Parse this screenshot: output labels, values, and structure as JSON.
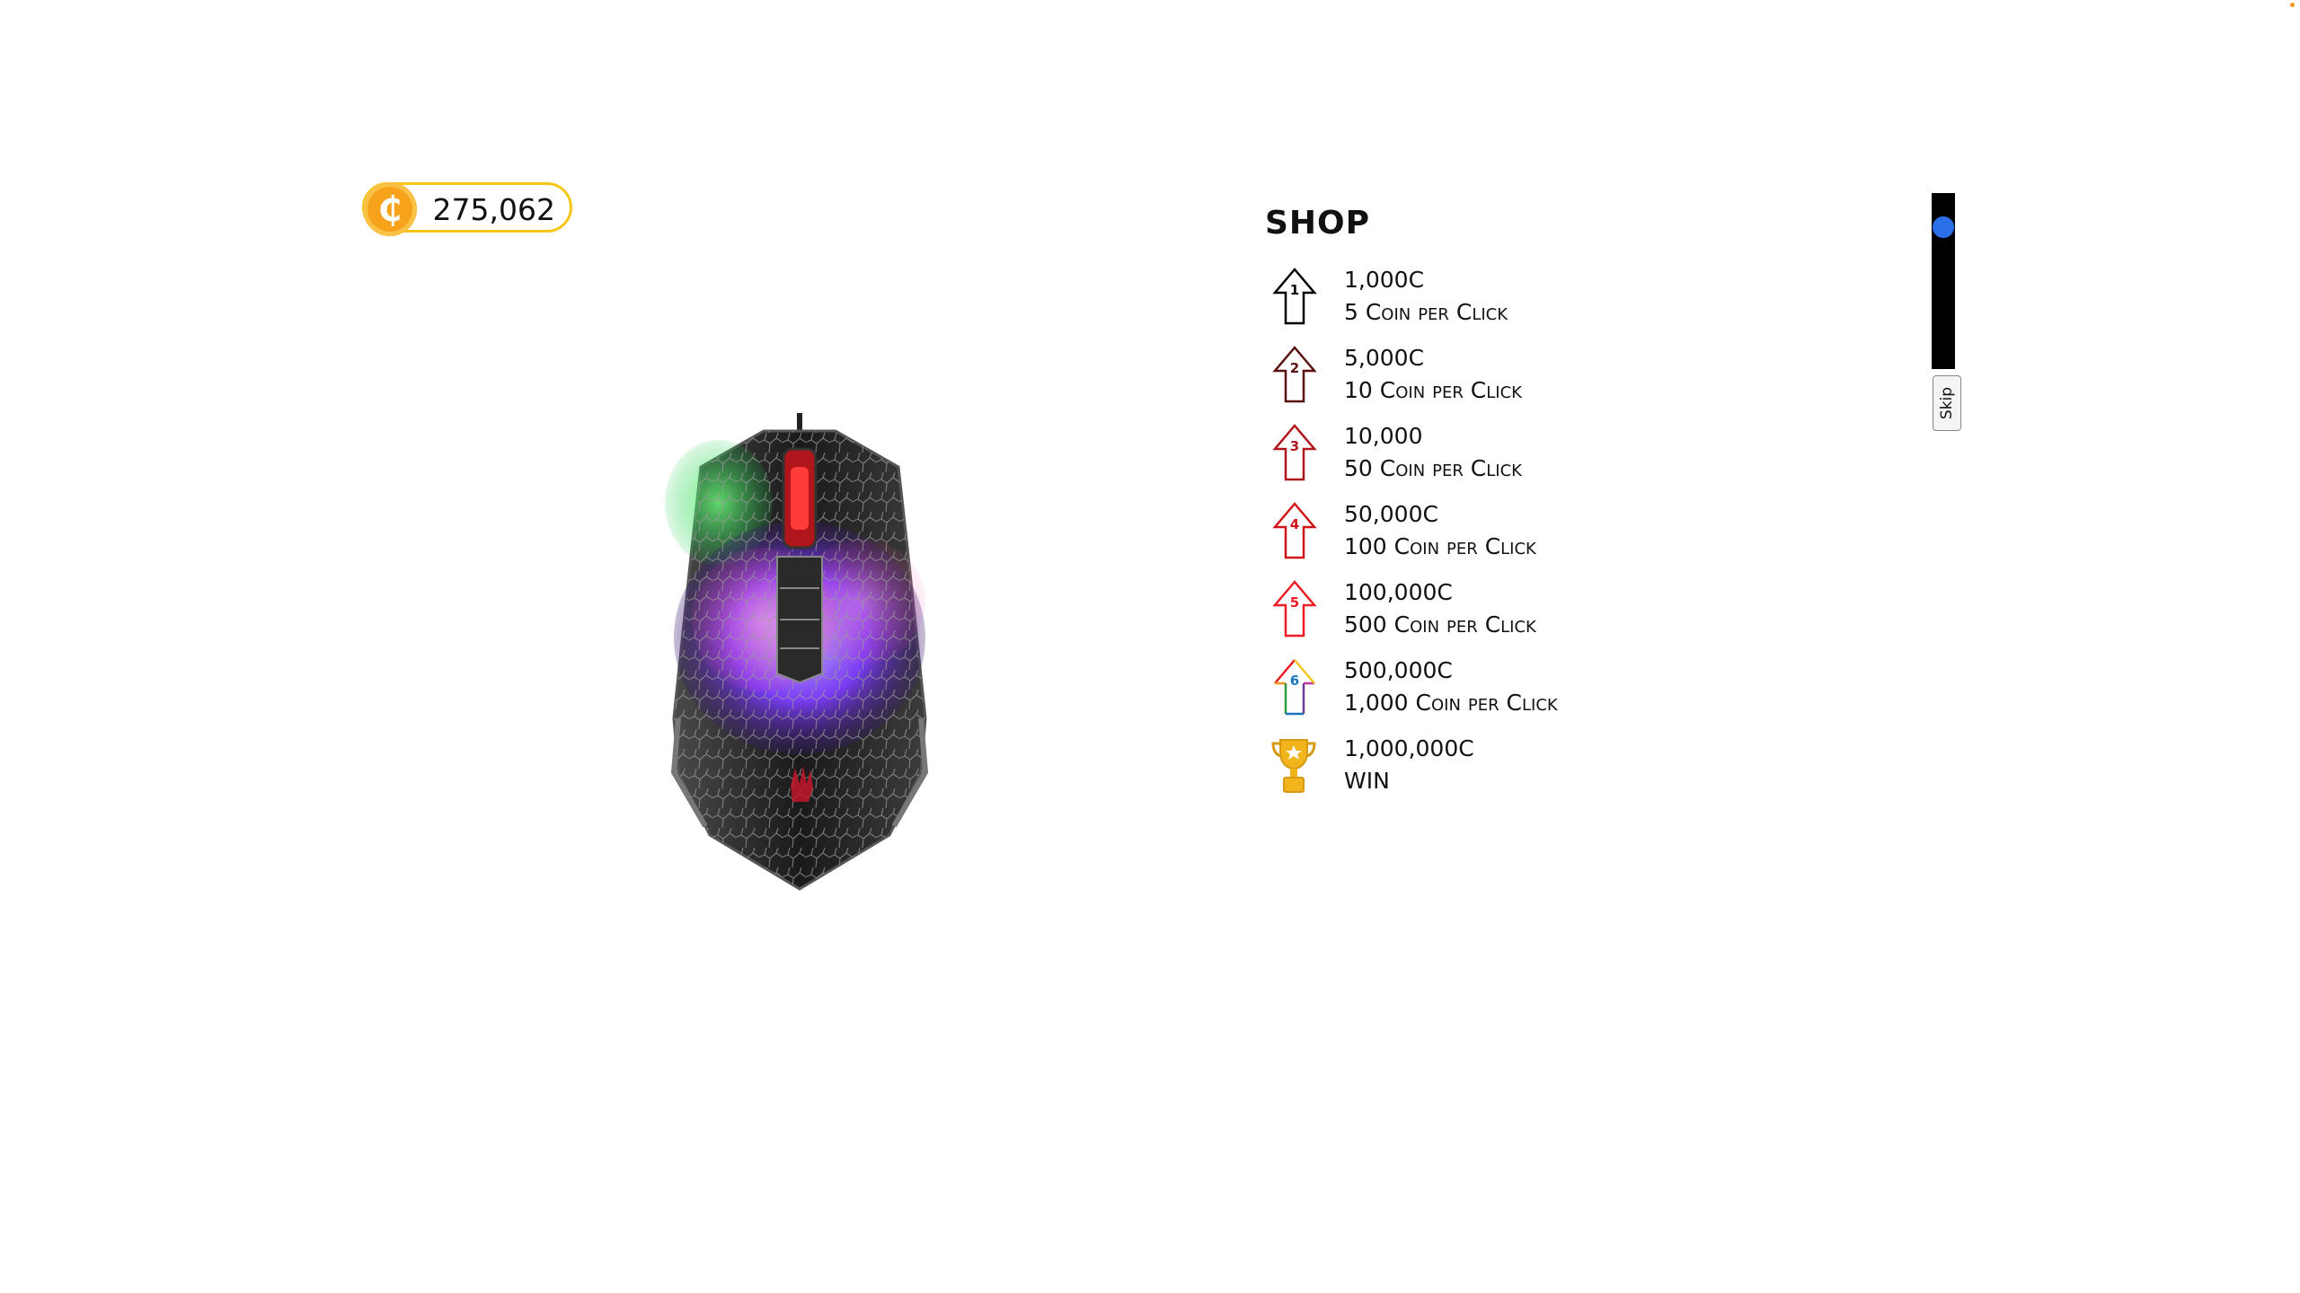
{
  "coin_counter": {
    "symbol": "₵",
    "value": "275,062"
  },
  "mouse": {
    "icon": "gaming-mouse"
  },
  "shop": {
    "title": "SHOP",
    "items": [
      {
        "level": "1",
        "price": "1,000C",
        "description": "5 Coin per Click",
        "icon": "arrow-up-icon",
        "color": "#000000"
      },
      {
        "level": "2",
        "price": "5,000C",
        "description": "10 Coin per Click",
        "icon": "arrow-up-icon",
        "color": "#5a0f10"
      },
      {
        "level": "3",
        "price": "10,000",
        "description": "50 Coin per Click",
        "icon": "arrow-up-icon",
        "color": "#b0151b"
      },
      {
        "level": "4",
        "price": "50,000C",
        "description": "100 Coin per Click",
        "icon": "arrow-up-icon",
        "color": "#d01418"
      },
      {
        "level": "5",
        "price": "100,000C",
        "description": "500 Coin per Click",
        "icon": "arrow-up-icon",
        "color": "#ee1c24"
      },
      {
        "level": "6",
        "price": "500,000C",
        "description": "1,000 Coin per Click",
        "icon": "rainbow-arrow-up-icon",
        "color": "rainbow"
      },
      {
        "level": "",
        "price": "1,000,000C",
        "description": "WIN",
        "icon": "trophy-icon",
        "color": "#f2b41c"
      }
    ]
  },
  "controls": {
    "slider_value": 0.85,
    "skip_label": "Skip",
    "knob_color": "#2a6fe8"
  }
}
